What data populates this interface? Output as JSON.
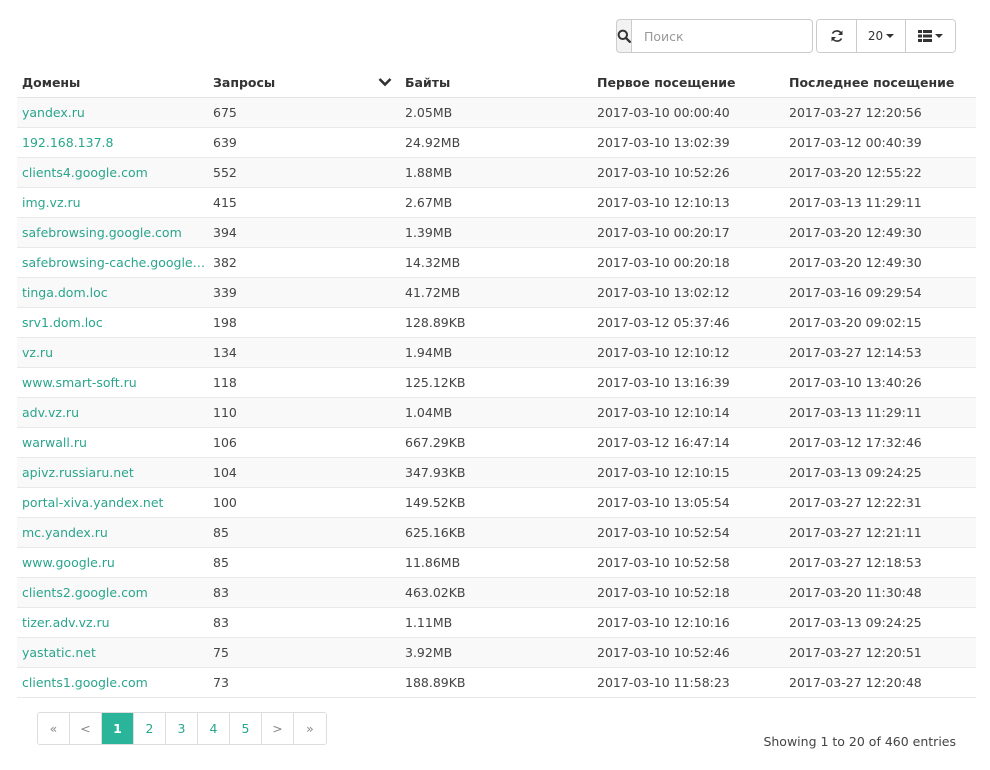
{
  "search": {
    "placeholder": "Поиск",
    "icon": "search-icon"
  },
  "toolbar": {
    "refresh_icon": "refresh-icon",
    "page_size": "20",
    "columns_icon": "columns-icon"
  },
  "table": {
    "columns": [
      "Домены",
      "Запросы",
      "Байты",
      "Первое посещение",
      "Последнее посещение"
    ],
    "sort_column": "Байты",
    "rows": [
      [
        "yandex.ru",
        "675",
        "2.05MB",
        "2017-03-10 00:00:40",
        "2017-03-27 12:20:56"
      ],
      [
        "192.168.137.8",
        "639",
        "24.92MB",
        "2017-03-10 13:02:39",
        "2017-03-12 00:40:39"
      ],
      [
        "clients4.google.com",
        "552",
        "1.88MB",
        "2017-03-10 10:52:26",
        "2017-03-20 12:55:22"
      ],
      [
        "img.vz.ru",
        "415",
        "2.67MB",
        "2017-03-10 12:10:13",
        "2017-03-13 11:29:11"
      ],
      [
        "safebrowsing.google.com",
        "394",
        "1.39MB",
        "2017-03-10 00:20:17",
        "2017-03-20 12:49:30"
      ],
      [
        "safebrowsing-cache.google.com",
        "382",
        "14.32MB",
        "2017-03-10 00:20:18",
        "2017-03-20 12:49:30"
      ],
      [
        "tinga.dom.loc",
        "339",
        "41.72MB",
        "2017-03-10 13:02:12",
        "2017-03-16 09:29:54"
      ],
      [
        "srv1.dom.loc",
        "198",
        "128.89KB",
        "2017-03-12 05:37:46",
        "2017-03-20 09:02:15"
      ],
      [
        "vz.ru",
        "134",
        "1.94MB",
        "2017-03-10 12:10:12",
        "2017-03-27 12:14:53"
      ],
      [
        "www.smart-soft.ru",
        "118",
        "125.12KB",
        "2017-03-10 13:16:39",
        "2017-03-10 13:40:26"
      ],
      [
        "adv.vz.ru",
        "110",
        "1.04MB",
        "2017-03-10 12:10:14",
        "2017-03-13 11:29:11"
      ],
      [
        "warwall.ru",
        "106",
        "667.29KB",
        "2017-03-12 16:47:14",
        "2017-03-12 17:32:46"
      ],
      [
        "apivz.russiaru.net",
        "104",
        "347.93KB",
        "2017-03-10 12:10:15",
        "2017-03-13 09:24:25"
      ],
      [
        "portal-xiva.yandex.net",
        "100",
        "149.52KB",
        "2017-03-10 13:05:54",
        "2017-03-27 12:22:31"
      ],
      [
        "mc.yandex.ru",
        "85",
        "625.16KB",
        "2017-03-10 10:52:54",
        "2017-03-27 12:21:11"
      ],
      [
        "www.google.ru",
        "85",
        "11.86MB",
        "2017-03-10 10:52:58",
        "2017-03-27 12:18:53"
      ],
      [
        "clients2.google.com",
        "83",
        "463.02KB",
        "2017-03-10 10:52:18",
        "2017-03-20 11:30:48"
      ],
      [
        "tizer.adv.vz.ru",
        "83",
        "1.11MB",
        "2017-03-10 12:10:16",
        "2017-03-13 09:24:25"
      ],
      [
        "yastatic.net",
        "75",
        "3.92MB",
        "2017-03-10 10:52:46",
        "2017-03-27 12:20:51"
      ],
      [
        "clients1.google.com",
        "73",
        "188.89KB",
        "2017-03-10 11:58:23",
        "2017-03-27 12:20:48"
      ]
    ]
  },
  "pagination": {
    "first": "«",
    "prev": "<",
    "pages": [
      "1",
      "2",
      "3",
      "4",
      "5"
    ],
    "active_page": "1",
    "next": ">",
    "last": "»"
  },
  "entries_info": "Showing 1 to 20 of 460 entries",
  "colors": {
    "accent": "#2ab59b",
    "link": "#2aa58d"
  }
}
